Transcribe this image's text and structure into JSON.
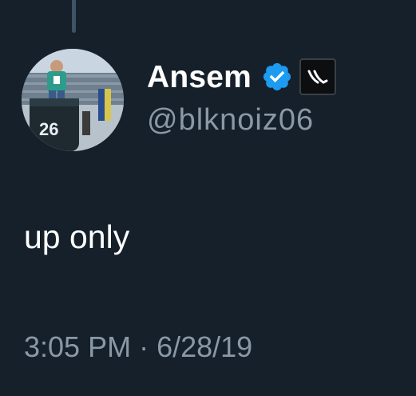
{
  "author": {
    "display_name": "Ansem",
    "handle": "@blknoiz06",
    "verified": true,
    "verified_icon": "verified-check-icon",
    "affiliate_icon": "affiliate-logo-icon",
    "avatar_icon": "profile-photo"
  },
  "tweet": {
    "text": "up only",
    "time": "3:05 PM",
    "separator": "·",
    "date": "6/28/19"
  },
  "colors": {
    "background": "#15202b",
    "primary_text": "#ffffff",
    "secondary_text": "#8b98a5",
    "verified_blue": "#1d9bf0",
    "thread_line": "#3d5466"
  }
}
